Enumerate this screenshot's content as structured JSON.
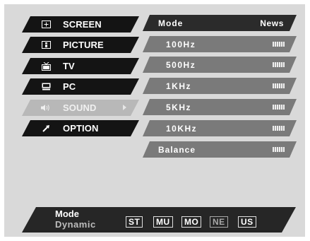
{
  "menu": {
    "items": [
      {
        "label": "SCREEN",
        "icon": "screen-icon",
        "active": false
      },
      {
        "label": "PICTURE",
        "icon": "picture-icon",
        "active": false
      },
      {
        "label": "TV",
        "icon": "tv-icon",
        "active": false
      },
      {
        "label": "PC",
        "icon": "pc-icon",
        "active": false
      },
      {
        "label": "SOUND",
        "icon": "speaker-icon",
        "active": true
      },
      {
        "label": "OPTION",
        "icon": "option-icon",
        "active": false
      }
    ]
  },
  "sound_panel": {
    "header": {
      "label": "Mode",
      "value": "News"
    },
    "rows": [
      {
        "label": "100Hz",
        "level_icon": "level-meter-icon"
      },
      {
        "label": "500Hz",
        "level_icon": "level-meter-icon"
      },
      {
        "label": "1KHz",
        "level_icon": "level-meter-icon"
      },
      {
        "label": "5KHz",
        "level_icon": "level-meter-icon"
      },
      {
        "label": "10KHz",
        "level_icon": "level-meter-icon"
      }
    ],
    "balance": {
      "label": "Balance",
      "level_icon": "level-meter-icon"
    }
  },
  "footer": {
    "mode_title": "Mode",
    "mode_value": "Dynamic",
    "chips": [
      "ST",
      "MU",
      "MO",
      "NE",
      "US"
    ],
    "current_chip": "NE"
  },
  "colors": {
    "menu_bg": "#141414",
    "menu_active_bg": "#b8b8b8",
    "row_bg": "#7a7a7a",
    "header_bg": "#2b2b2b",
    "frame_bg": "#d9d9d9"
  }
}
